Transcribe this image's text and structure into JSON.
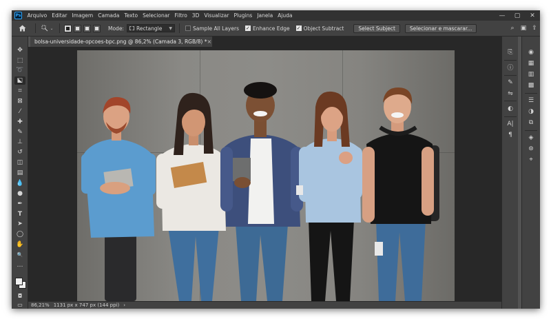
{
  "app": {
    "logo_text": "Ps",
    "menu": [
      "Arquivo",
      "Editar",
      "Imagem",
      "Camada",
      "Texto",
      "Selecionar",
      "Filtro",
      "3D",
      "Visualizar",
      "Plugins",
      "Janela",
      "Ajuda"
    ]
  },
  "window_controls": {
    "minimize": "—",
    "maximize": "▢",
    "close": "✕"
  },
  "options_bar": {
    "mode_label": "Mode:",
    "mode_value": "Rectangle",
    "sample_all_layers": {
      "label": "Sample All Layers",
      "checked": false
    },
    "enhance_edge": {
      "label": "Enhance Edge",
      "checked": true
    },
    "object_subtract": {
      "label": "Object Subtract",
      "checked": true
    },
    "select_subject_label": "Select Subject",
    "select_mask_label": "Selecionar e mascarar..."
  },
  "document": {
    "tab_title": "bolsa-universidade-opcoes-bpc.png @ 86,2% (Camada 3, RGB/8) *",
    "close_glyph": "×"
  },
  "status": {
    "zoom": "86,21%",
    "dimensions": "1131 px x 747 px (144 ppi)",
    "caret": "›"
  },
  "icons": {
    "tools": [
      "move-icon",
      "marquee-icon",
      "lasso-icon",
      "object-selection-icon",
      "crop-icon",
      "frame-icon",
      "eyedropper-icon",
      "healing-icon",
      "brush-icon",
      "clone-stamp-icon",
      "history-brush-icon",
      "eraser-icon",
      "gradient-icon",
      "blur-icon",
      "dodge-icon",
      "pen-icon",
      "type-icon",
      "path-selection-icon",
      "ellipse-icon",
      "hand-icon",
      "zoom-icon",
      "more-tools-icon"
    ],
    "tool_glyphs": [
      "✥",
      "⬚",
      "➰",
      "⬕",
      "⌗",
      "⊠",
      "⁄",
      "✚",
      "✎",
      "⊥",
      "↺",
      "◫",
      "▤",
      "💧",
      "●",
      "✒",
      "T",
      "➤",
      "◯",
      "✋",
      "🔍",
      "…"
    ]
  },
  "colors": {
    "panel_bg": "#424242",
    "canvas_bg": "#282828",
    "menubar_bg": "#323232",
    "photo_wall": "#8a8985"
  }
}
